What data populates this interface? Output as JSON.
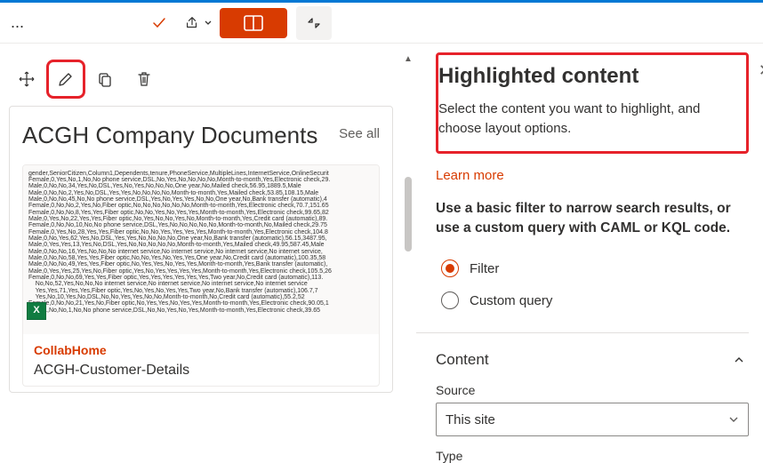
{
  "topbar": {
    "more_label": "..."
  },
  "toolbar": {},
  "webpart": {
    "title": "ACGH Company Documents",
    "see_all_label": "See all",
    "doc": {
      "site": "CollabHome",
      "name": "ACGH-Customer-Details",
      "icon_letter": "X",
      "preview_text": "gender,SeniorCitizen,Column1,Dependents,tenure,PhoneService,MultipleLines,InternetService,OnlineSecurit\nFemale,0,Yes,No,1,No,No phone service,DSL,No,Yes,No,No,No,No,Month-to-month,Yes,Electronic check,29.\nMale,0,No,No,34,Yes,No,DSL,Yes,No,Yes,No,No,No,One year,No,Mailed check,56.95,1889.5,Male\nMale,0,No,No,2,Yes,No,DSL,Yes,Yes,No,No,No,No,Month-to-month,Yes,Mailed check,53.85,108.15,Male\nMale,0,No,No,45,No,No phone service,DSL,Yes,No,Yes,Yes,No,No,One year,No,Bank transfer (automatic),4\nFemale,0,No,No,2,Yes,No,Fiber optic,No,No,No,No,No,No,Month-to-month,Yes,Electronic check,70.7,151.65\nFemale,0,No,No,8,Yes,Yes,Fiber optic,No,No,Yes,No,Yes,Yes,Month-to-month,Yes,Electronic check,99.65,82\nMale,0,Yes,No,22,Yes,Yes,Fiber optic,No,Yes,No,No,Yes,No,Month-to-month,Yes,Credit card (automatic),89.\nFemale,0,No,No,10,No,No phone service,DSL,Yes,No,No,No,No,No,Month-to-month,No,Mailed check,29.75\nFemale,0,Yes,No,28,Yes,Yes,Fiber optic,No,No,Yes,Yes,Yes,Yes,Month-to-month,Yes,Electronic check,104.8\nMale,0,No,Yes,62,Yes,No,DSL,Yes,Yes,No,No,No,No,One year,No,Bank transfer (automatic),56.15,3487.95,\nMale,0,Yes,Yes,13,Yes,No,DSL,Yes,No,No,No,No,No,Month-to-month,Yes,Mailed check,49.95,587.45,Male\nMale,0,No,No,16,Yes,No,No,No internet service,No internet service,No internet service,No internet service,\nMale,0,No,No,58,Yes,Yes,Fiber optic,No,No,Yes,No,Yes,Yes,One year,No,Credit card (automatic),100.35,58\nMale,0,No,No,49,Yes,Yes,Fiber optic,No,Yes,Yes,No,Yes,Yes,Month-to-month,Yes,Bank transfer (automatic),\nMale,0,Yes,Yes,25,Yes,No,Fiber optic,Yes,No,Yes,Yes,Yes,Yes,Month-to-month,Yes,Electronic check,105.5,26\nFemale,0,No,No,69,Yes,Yes,Fiber optic,Yes,Yes,Yes,Yes,Yes,Yes,Two year,No,Credit card (automatic),113.\n    No,No,52,Yes,No,No,No internet service,No internet service,No internet service,No internet service\n    Yes,Yes,71,Yes,Yes,Fiber optic,Yes,No,Yes,No,Yes,Yes,Two year,No,Bank transfer (automatic),106.7,7\n    Yes,No,10,Yes,No,DSL,No,No,Yes,Yes,No,No,Month-to-month,No,Credit card (automatic),55.2,52\nFemale,0,No,No,21,Yes,No,Fiber optic,No,Yes,Yes,No,Yes,Yes,Month-to-month,Yes,Electronic check,90.05,1\nMale,1,No,No,1,No,No phone service,DSL,No,No,Yes,No,Yes,Month-to-month,Yes,Electronic check,39.65"
    }
  },
  "panel": {
    "title": "Highlighted content",
    "description": "Select the content you want to highlight, and choose layout options.",
    "learn_more_label": "Learn more",
    "filter_intro": "Use a basic filter to narrow search results, or use a custom query with CAML or KQL code.",
    "radio_filter_label": "Filter",
    "radio_custom_label": "Custom query",
    "content_section_label": "Content",
    "source_field_label": "Source",
    "source_selected": "This site",
    "type_field_label": "Type"
  }
}
